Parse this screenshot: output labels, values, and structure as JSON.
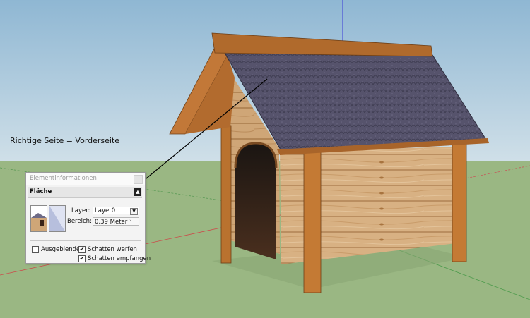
{
  "annotation": {
    "text": "Richtige Seite = Vorderseite"
  },
  "entity_info": {
    "title": "Elementinformationen",
    "section": "Fläche",
    "layer_label": "Layer:",
    "layer_value": "Layer0",
    "area_label": "Bereich:",
    "area_value": "0,39 Meter ²",
    "hidden_label": "Ausgeblendet",
    "hidden_checked": false,
    "cast_shadows_label": "Schatten werfen",
    "cast_shadows_checked": true,
    "receive_shadows_label": "Schatten empfangen",
    "receive_shadows_checked": true
  },
  "colors": {
    "sky": "#aec9dd",
    "ground": "#9bb883",
    "wood": "#c8823e",
    "roof": "#55526a",
    "back_face": "#b7bfdd"
  }
}
